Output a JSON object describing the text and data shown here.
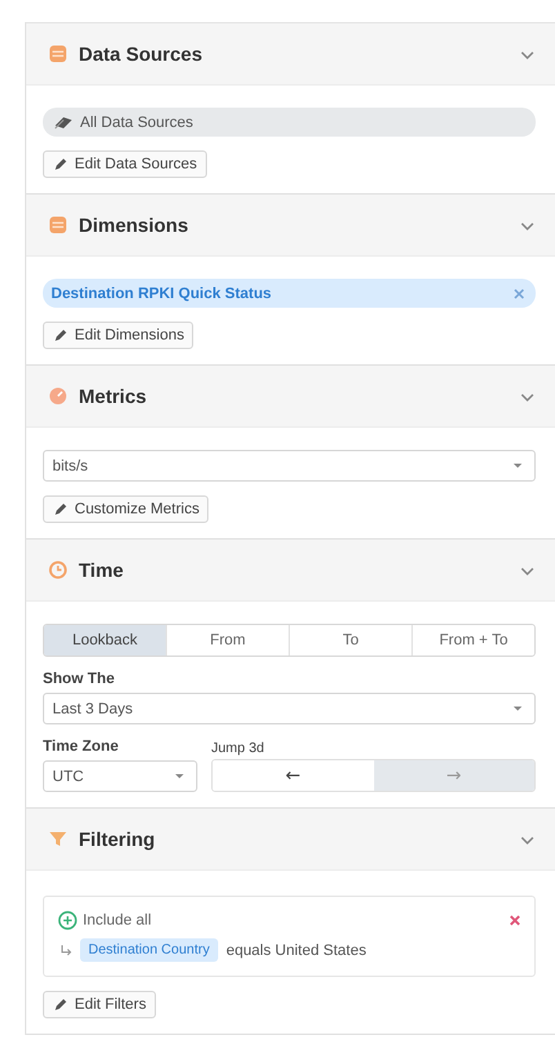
{
  "sections": [
    {
      "title": "Data Sources",
      "kind": "data_sources",
      "body": [
        {
          "kind": "pill",
          "label": "All Data Sources"
        },
        {
          "kind": "edit_button",
          "label": "Edit Data Sources"
        }
      ]
    },
    {
      "title": "Dimensions",
      "kind": "dimensions",
      "body": [
        {
          "kind": "tag",
          "label": "Destination RPKI Quick Status"
        },
        {
          "kind": "edit_button",
          "label": "Edit Dimensions"
        }
      ]
    },
    {
      "title": "Metrics",
      "kind": "metrics",
      "body": [
        {
          "kind": "select",
          "value": "bits/s"
        },
        {
          "kind": "edit_button",
          "label": "Customize Metrics"
        }
      ]
    },
    {
      "title": "Time",
      "kind": "time",
      "body": [
        {
          "kind": "segmented",
          "options": [
            {
              "label": "Lookback",
              "selected": true
            },
            {
              "label": "From",
              "selected": false
            },
            {
              "label": "To",
              "selected": false
            },
            {
              "label": "From + To",
              "selected": false
            }
          ]
        },
        {
          "kind": "select",
          "label": "Show The",
          "value": "Last 3 Days"
        },
        {
          "kind": "timezone_jump",
          "timezone": {
            "label": "Time Zone",
            "value": "UTC"
          },
          "jump": {
            "label": "Jump 3d",
            "buttons": [
              {
                "symbol": "←",
                "disabled": false
              },
              {
                "symbol": "→",
                "disabled": true
              }
            ]
          }
        }
      ]
    },
    {
      "title": "Filtering",
      "kind": "filtering",
      "body": [
        {
          "kind": "filter_group",
          "mode": "Include all",
          "conditions": [
            {
              "field": "Destination Country",
              "operator": "equals",
              "value": "United States"
            }
          ]
        },
        {
          "kind": "edit_button",
          "label": "Edit Filters"
        }
      ]
    }
  ]
}
